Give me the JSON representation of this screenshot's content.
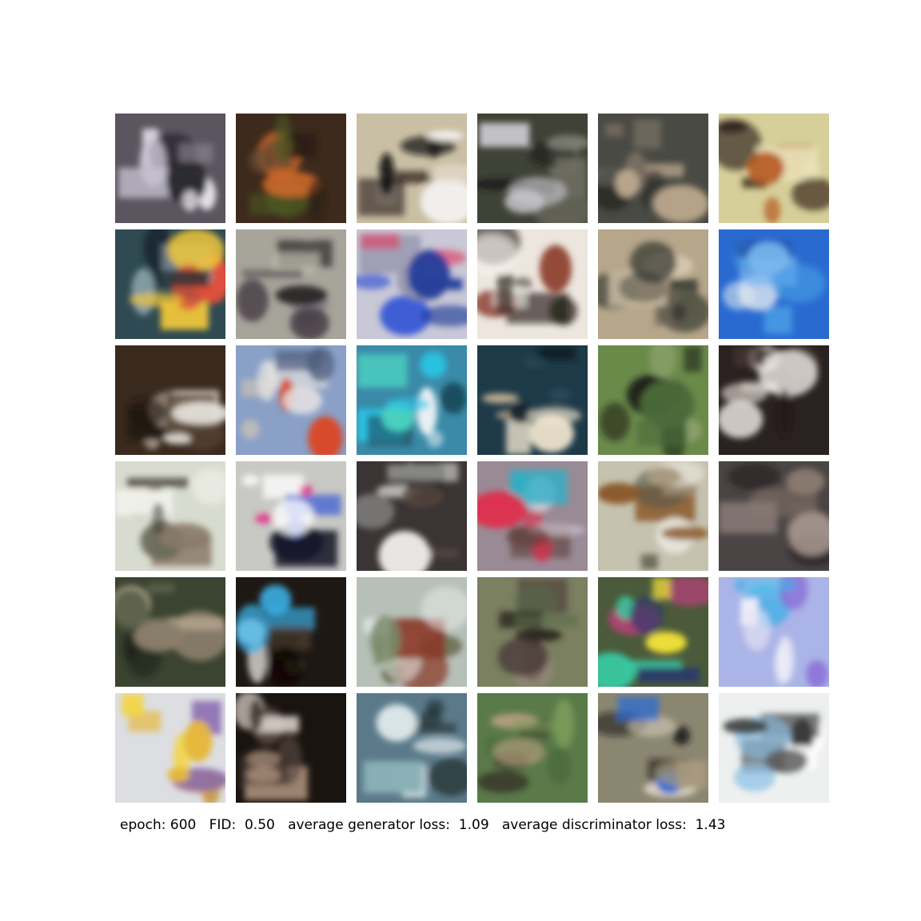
{
  "caption": {
    "epoch": "epoch: 600",
    "fid": "FID:  0.50",
    "gen_loss": "average generator loss:  1.09",
    "disc_loss": "average discriminator loss:  1.43"
  },
  "grid": {
    "rows": 6,
    "cols": 6,
    "tiles": [
      {
        "bg": "#5b5560",
        "blobs": [
          "#e6e2ea",
          "#2a2630",
          "#8c8896",
          "#c9c4d4"
        ]
      },
      {
        "bg": "#3d2a1c",
        "blobs": [
          "#4a5a22",
          "#d06a2a",
          "#6b4a30",
          "#2a1e14"
        ]
      },
      {
        "bg": "#c9bfa4",
        "blobs": [
          "#0c0a0a",
          "#f4f0ee",
          "#2a2220",
          "#e6ddd0"
        ]
      },
      {
        "bg": "#3f4236",
        "blobs": [
          "#c8c6cc",
          "#1c1c1a",
          "#6b6b5e",
          "#8a8a80"
        ]
      },
      {
        "bg": "#4a4a44",
        "blobs": [
          "#b7a48a",
          "#2a2a28",
          "#8d7e6e",
          "#6e6a5e"
        ]
      },
      {
        "bg": "#d6cf9a",
        "blobs": [
          "#b4541c",
          "#1e120c",
          "#e9e2b8",
          "#3a2a1a"
        ]
      },
      {
        "bg": "#2f4a52",
        "blobs": [
          "#f2c83a",
          "#e0503a",
          "#1a2630",
          "#8aa0a8"
        ]
      },
      {
        "bg": "#a7a49a",
        "blobs": [
          "#4a4048",
          "#6a6070",
          "#c8c4b6",
          "#2a2628"
        ]
      },
      {
        "bg": "#c9c8d6",
        "blobs": [
          "#1e3a9a",
          "#3a5ad6",
          "#e23a5a",
          "#8a8aa4"
        ]
      },
      {
        "bg": "#ece6de",
        "blobs": [
          "#1a1410",
          "#8a3a2a",
          "#3a3028",
          "#f6f2ec"
        ]
      },
      {
        "bg": "#b6a68a",
        "blobs": [
          "#2a2e2a",
          "#5a5a4a",
          "#d6c8b0",
          "#6a6456"
        ]
      },
      {
        "bg": "#2a6ad0",
        "blobs": [
          "#4aa0e6",
          "#dfe8f0",
          "#1a4aa0",
          "#7ab8f0"
        ]
      },
      {
        "bg": "#3a2a1e",
        "blobs": [
          "#ece8e2",
          "#c8bcb0",
          "#5a4634",
          "#1e1610"
        ]
      },
      {
        "bg": "#8aa0c6",
        "blobs": [
          "#eae6e4",
          "#d84a2a",
          "#4a5a7a",
          "#c6c0b8"
        ]
      },
      {
        "bg": "#3a8aa8",
        "blobs": [
          "#2ac6e6",
          "#e6f0f4",
          "#1a4a5a",
          "#4ad0c0"
        ]
      },
      {
        "bg": "#1e3a48",
        "blobs": [
          "#f2e6d0",
          "#e6c8a0",
          "#2a4a5a",
          "#0e1e28"
        ]
      },
      {
        "bg": "#6a8a4a",
        "blobs": [
          "#1a1a14",
          "#8aa06a",
          "#3a4a2a",
          "#4a6a3a"
        ]
      },
      {
        "bg": "#2a2220",
        "blobs": [
          "#f0ece8",
          "#c8c0ba",
          "#4a3a34",
          "#1a1412"
        ]
      },
      {
        "bg": "#d8dcd0",
        "blobs": [
          "#3a3430",
          "#6a6a5a",
          "#f2f2ec",
          "#8a7a6a"
        ]
      },
      {
        "bg": "#c8c8c4",
        "blobs": [
          "#ffffff",
          "#e23a8a",
          "#1a1a2a",
          "#3a5ad6"
        ]
      },
      {
        "bg": "#3a3434",
        "blobs": [
          "#f2f0ee",
          "#0e0c0c",
          "#8a8a88",
          "#5a4a44"
        ]
      },
      {
        "bg": "#9a8a96",
        "blobs": [
          "#e22a4a",
          "#d8d0da",
          "#2ab0c6",
          "#5a3a34"
        ]
      },
      {
        "bg": "#c6c2b0",
        "blobs": [
          "#8a5a2a",
          "#ece8de",
          "#5a5a4a",
          "#a89a80"
        ]
      },
      {
        "bg": "#4a4444",
        "blobs": [
          "#8a7a6e",
          "#2a2424",
          "#6a5e58",
          "#a89890"
        ]
      },
      {
        "bg": "#3a4430",
        "blobs": [
          "#8a7e6a",
          "#1e221a",
          "#b8a890",
          "#5a6048"
        ]
      },
      {
        "bg": "#1e1814",
        "blobs": [
          "#3ab0e6",
          "#f4f0ec",
          "#5a4a3a",
          "#0a0806"
        ]
      },
      {
        "bg": "#b6c0b8",
        "blobs": [
          "#e6e8e4",
          "#5a5e3a",
          "#8a3a2a",
          "#7a8a6a"
        ]
      },
      {
        "bg": "#7a8060",
        "blobs": [
          "#4a3a3a",
          "#9a8a7a",
          "#5a6a4a",
          "#2a2620"
        ]
      },
      {
        "bg": "#4a5a3a",
        "blobs": [
          "#3ac6a0",
          "#d63a8a",
          "#f2e23a",
          "#2a3a6a"
        ]
      },
      {
        "bg": "#aab4e6",
        "blobs": [
          "#e6e2f4",
          "#8a6ad6",
          "#3ab0e6",
          "#f2f0fa"
        ]
      },
      {
        "bg": "#dcdee2",
        "blobs": [
          "#e6b83a",
          "#c6902a",
          "#f2d64a",
          "#8a6ab0"
        ]
      },
      {
        "bg": "#1a1410",
        "blobs": [
          "#c8a890",
          "#5a4a44",
          "#e6dcd4",
          "#3a302a"
        ]
      },
      {
        "bg": "#5a7a8a",
        "blobs": [
          "#e6eef0",
          "#1a2a2a",
          "#8ab0b6",
          "#2a3a3a"
        ]
      },
      {
        "bg": "#5a7a4a",
        "blobs": [
          "#3a3a2a",
          "#c8a88a",
          "#7a9a5a",
          "#4a6a3a"
        ]
      },
      {
        "bg": "#8a8670",
        "blobs": [
          "#1a1614",
          "#d8d0c0",
          "#2a6ad6",
          "#a89a80"
        ]
      },
      {
        "bg": "#eef0f0",
        "blobs": [
          "#3a3a3a",
          "#8ac0e6",
          "#ffffff",
          "#5a5a5a"
        ]
      }
    ]
  }
}
